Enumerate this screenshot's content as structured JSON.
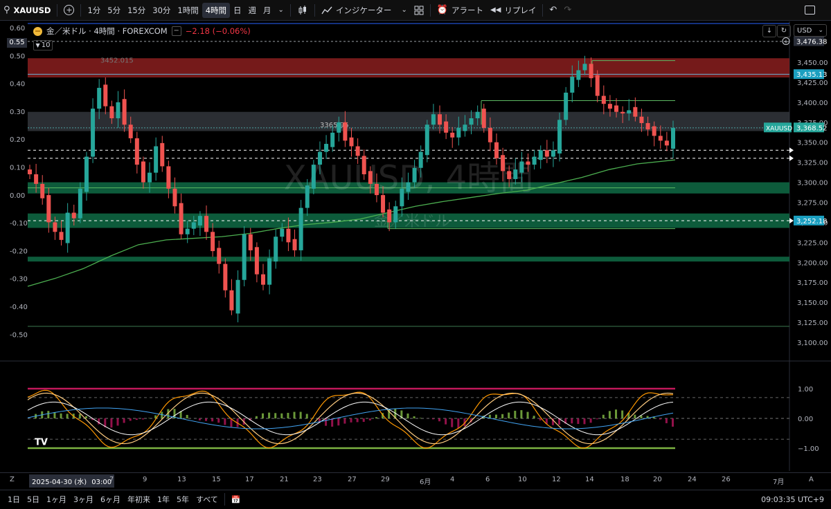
{
  "toolbar": {
    "symbol": "XAUUSD",
    "intervals": [
      "1分",
      "5分",
      "15分",
      "30分",
      "1時間",
      "4時間",
      "日",
      "週",
      "月"
    ],
    "selected_interval": "4時間",
    "indicators_label": "インジケーター",
    "alert_label": "アラート",
    "replay_label": "リプレイ"
  },
  "legend": {
    "title": "金／米ドル · 4時間 · FOREXCOM",
    "change": "−2.18 (−0.06%)",
    "collapse_count": "10"
  },
  "watermark": {
    "symbol": "XAUUSD, 4時間",
    "name": "金／米ドル"
  },
  "price_scale": {
    "currency": "USD",
    "ticks": [
      "3,450.00",
      "3,425.00",
      "3,400.00",
      "3,375.00",
      "3,350.00",
      "3,325.00",
      "3,300.00",
      "3,275.00",
      "3,250.00",
      "3,225.00",
      "3,200.00",
      "3,175.00",
      "3,150.00",
      "3,125.00",
      "3,100.00"
    ],
    "tag_top": "3,476.38",
    "tag_resist": "3,435.13",
    "tag_last_symbol": "XAUUSD",
    "tag_last": "3,368.52",
    "tag_support": "3,252.18"
  },
  "left_scale": {
    "ticks": [
      "0.60",
      "0.50",
      "0.40",
      "0.30",
      "0.20",
      "0.10",
      "0.00",
      "-0.10",
      "-0.20",
      "-0.30",
      "-0.40",
      "-0.50"
    ],
    "highlight": "0.55"
  },
  "annotations": {
    "high_label": "3452.015",
    "mid_label": "3365.96"
  },
  "oscillator": {
    "ticks": [
      "1.00",
      "0.00",
      "−1.00"
    ]
  },
  "time_axis": {
    "cursor_date": "2025-04-30 (水)",
    "cursor_time": "03:00",
    "labels": [
      "7",
      "9",
      "13",
      "15",
      "17",
      "21",
      "23",
      "27",
      "29",
      "6月",
      "4",
      "6",
      "10",
      "12",
      "14",
      "18",
      "20",
      "24",
      "26",
      "7月"
    ]
  },
  "bottom": {
    "ranges": [
      "1日",
      "5日",
      "1ヶ月",
      "3ヶ月",
      "6ヶ月",
      "年初来",
      "1年",
      "5年",
      "すべて"
    ],
    "clock": "09:03:35 UTC+9"
  },
  "colors": {
    "up": "#26a69a",
    "down": "#ef5350",
    "ma": "#4caf50",
    "zone_green": "#0f6b45",
    "zone_red": "#7a1c1c",
    "accent": "#2962ff"
  },
  "chart_data": {
    "type": "candlestick",
    "price_range": [
      3090,
      3490
    ],
    "levels": {
      "resistance_zone": [
        3431,
        3455
      ],
      "gray_zone": [
        3364,
        3388
      ],
      "support_zone_1": [
        3286,
        3300
      ],
      "support_zone_2": [
        3243,
        3261
      ],
      "support_zone_3": [
        3201,
        3207
      ]
    },
    "close_series": [
      3310,
      3298,
      3280,
      3250,
      3238,
      3228,
      3262,
      3255,
      3292,
      3332,
      3392,
      3418,
      3395,
      3380,
      3400,
      3372,
      3355,
      3322,
      3300,
      3312,
      3345,
      3320,
      3292,
      3270,
      3235,
      3242,
      3250,
      3258,
      3238,
      3214,
      3198,
      3165,
      3140,
      3178,
      3235,
      3215,
      3185,
      3172,
      3205,
      3232,
      3242,
      3225,
      3215,
      3268,
      3296,
      3322,
      3338,
      3348,
      3362,
      3375,
      3352,
      3345,
      3333,
      3310,
      3298,
      3284,
      3262,
      3250,
      3270,
      3292,
      3300,
      3318,
      3338,
      3372,
      3385,
      3372,
      3362,
      3356,
      3368,
      3372,
      3380,
      3388,
      3368,
      3350,
      3330,
      3314,
      3304,
      3316,
      3326,
      3322,
      3332,
      3340,
      3332,
      3340,
      3378,
      3412,
      3432,
      3440,
      3448,
      3430,
      3408,
      3398,
      3392,
      3388,
      3386,
      3390,
      3382,
      3374,
      3366,
      3358,
      3352,
      3346,
      3368
    ]
  }
}
